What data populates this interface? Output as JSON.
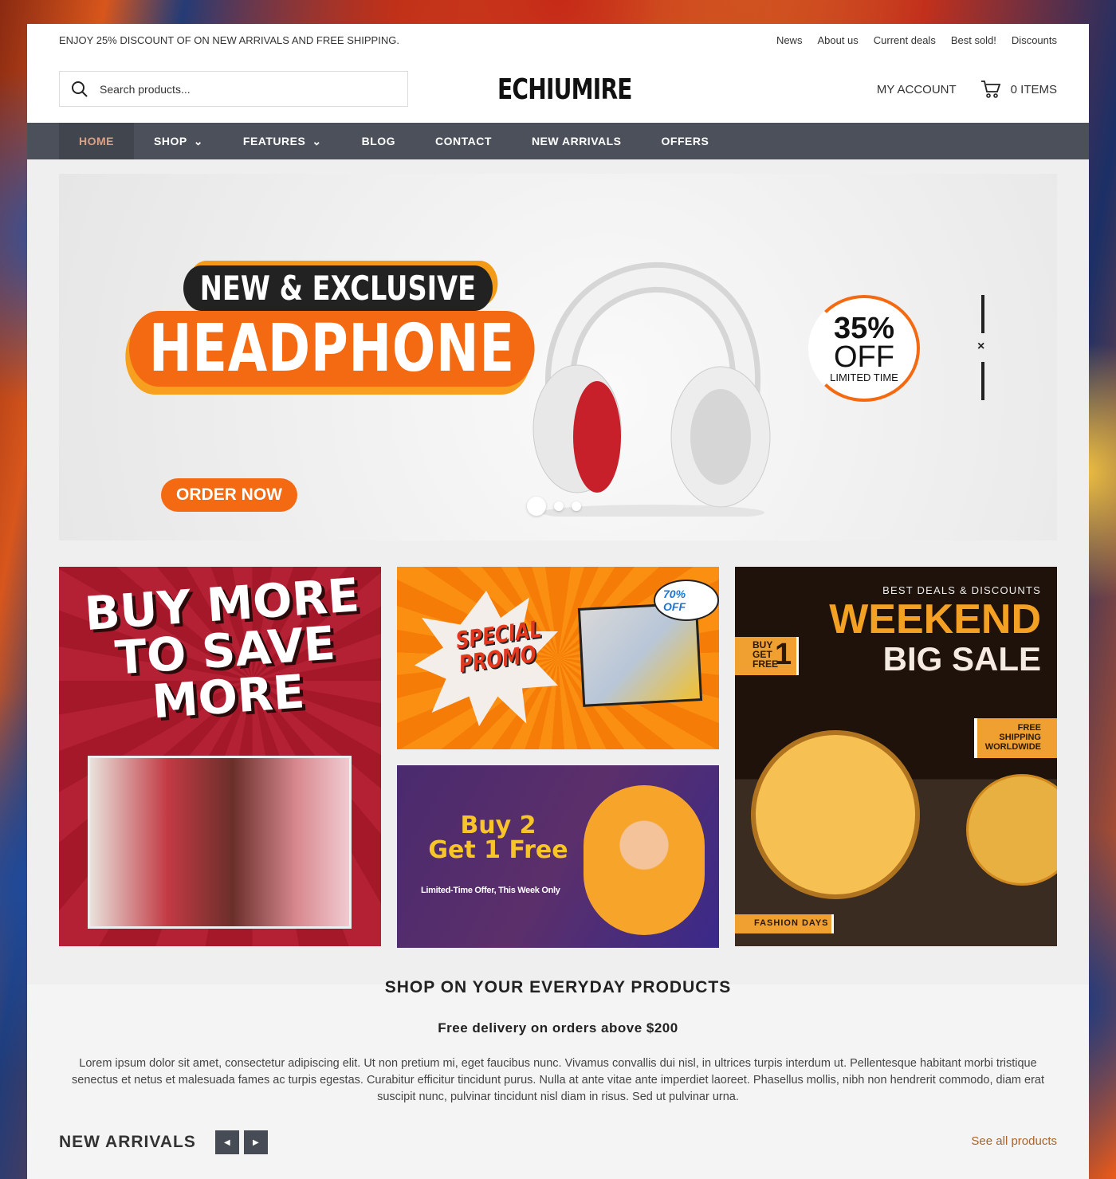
{
  "topbar": {
    "promo": "ENJOY 25% DISCOUNT OF ON NEW ARRIVALS AND FREE SHIPPING.",
    "links": [
      "News",
      "About us",
      "Current deals",
      "Best sold!",
      "Discounts"
    ]
  },
  "header": {
    "search_placeholder": "Search products...",
    "logo": "ECHIUMIRE",
    "account": "MY ACCOUNT",
    "cart": "0 ITEMS"
  },
  "nav": {
    "items": [
      "HOME",
      "SHOP",
      "FEATURES",
      "BLOG",
      "CONTACT",
      "NEW ARRIVALS",
      "OFFERS"
    ],
    "active": "HOME"
  },
  "hero": {
    "tag": "NEW & EXCLUSIVE",
    "title": "HEADPHONE",
    "cta": "ORDER NOW",
    "badge_percent": "35%",
    "badge_off": "OFF",
    "badge_note": "LIMITED TIME",
    "close": "×",
    "slides": 3,
    "active_slide": 1
  },
  "tiles": {
    "t1": {
      "headline": [
        "BUY MORE",
        "TO SAVE",
        "MORE"
      ]
    },
    "t2": {
      "headline": [
        "SPECIAL",
        "PROMO"
      ],
      "bubble": "70% OFF"
    },
    "t3": {
      "line1": "Buy 2",
      "line2": "Get 1 Free",
      "sub": "Limited-Time Offer, This Week Only"
    },
    "t4": {
      "top": "BEST DEALS & DISCOUNTS",
      "weekend": "WEEKEND",
      "bigsale": "BIG SALE",
      "buy": [
        "BUY",
        "GET",
        "FREE"
      ],
      "one": "1",
      "shipping": [
        "FREE",
        "SHIPPING",
        "WORLDWIDE"
      ],
      "fashion": "FASHION DAYS"
    }
  },
  "section": {
    "title": "SHOP ON YOUR EVERYDAY PRODUCTS",
    "subtitle": "Free delivery on orders above $200",
    "body": "Lorem ipsum dolor sit amet, consectetur adipiscing elit. Ut non pretium mi, eget faucibus nunc. Vivamus convallis dui nisl, in ultrices turpis interdum ut. Pellentesque habitant morbi tristique senectus et netus et malesuada fames ac turpis egestas. Curabitur efficitur tincidunt purus. Nulla at ante vitae ante imperdiet laoreet. Phasellus mollis, nibh non hendrerit commodo, diam erat suscipit nunc, pulvinar tincidunt nisl diam in risus. Sed ut pulvinar urna."
  },
  "arrivals": {
    "title": "NEW ARRIVALS",
    "prev": "◀",
    "next": "▶",
    "see_all": "See all products"
  },
  "colors": {
    "accent": "#f46a12",
    "nav_bg": "#4b505a",
    "nav_active_text": "#d9a286",
    "link": "#a8632a"
  }
}
